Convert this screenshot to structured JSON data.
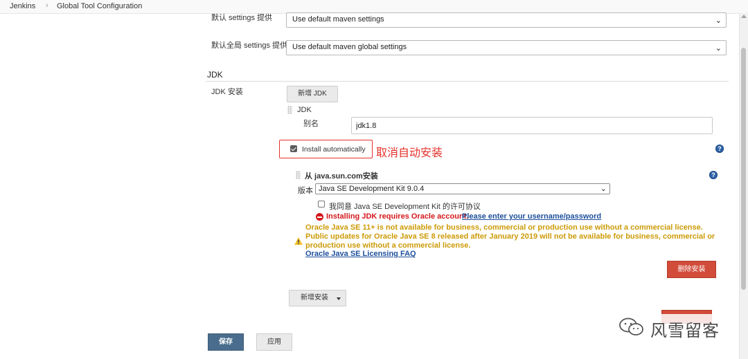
{
  "breadcrumb": {
    "items": [
      "Jenkins",
      "Global Tool Configuration"
    ],
    "separator": "›"
  },
  "maven": {
    "settings_label": "默认 settings 提供",
    "settings_value": "Use default maven settings",
    "global_settings_label": "默认全局 settings 提供",
    "global_settings_value": "Use default maven global settings"
  },
  "jdk": {
    "section_title": "JDK",
    "install_label": "JDK 安装",
    "add_button": "新增 JDK",
    "item_title": "JDK",
    "alias_label": "别名",
    "alias_value": "jdk1.8",
    "install_auto_label": "Install automatically",
    "install_auto_checked": true,
    "annotation": "取消自动安装",
    "installer": {
      "title": "从 java.sun.com安装",
      "version_label": "版本",
      "version_value": "Java SE Development Kit 9.0.4",
      "agree_label": "我同意 Java SE Development Kit 的许可协议",
      "agree_checked": false,
      "error_text": "Installing JDK requires Oracle account.",
      "error_link": "Please enter your username/password",
      "warning_lines": [
        "Oracle Java SE 11+ is not available for business, commercial or production use without a commercial license.",
        "Public updates for Oracle Java SE 8 released after January 2019 will not be available for business, commercial or",
        "production use without a commercial license."
      ],
      "warning_link": "Oracle Java SE Licensing FAQ",
      "delete_installer_button": "删除安装"
    },
    "add_installer_button": "新增安装"
  },
  "footer": {
    "save_button": "保存",
    "apply_button": "应用"
  },
  "watermark": {
    "text": "风雪留客",
    "icon": "wechat-icon"
  },
  "colors": {
    "annotation_red": "#e4312b",
    "error_red": "#d4171b",
    "warning_yellow": "#cc9a06",
    "link_blue": "#1d4e9b",
    "delete_button_red": "#d24c3a",
    "save_button_blue": "#4a6d8d"
  },
  "icons": {
    "help": "help-icon",
    "error": "error-icon",
    "warning": "warning-icon",
    "dropdown": "chevron-down-icon",
    "drag": "drag-handle-icon"
  }
}
